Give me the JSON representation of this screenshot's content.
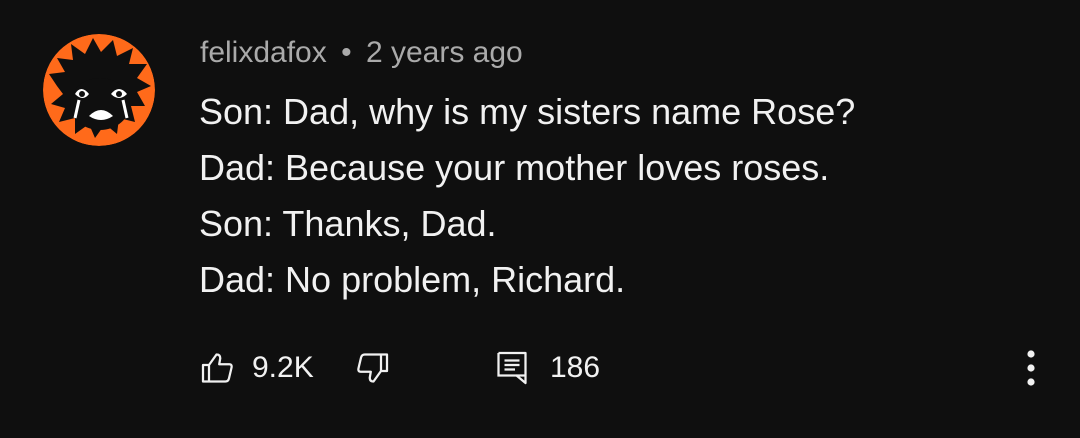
{
  "comment": {
    "author": "felixdafox",
    "separator": "•",
    "timestamp": "2 years ago",
    "lines": [
      "Son: Dad, why is my sisters name Rose?",
      "Dad: Because your mother loves roses.",
      "Son: Thanks, Dad.",
      "Dad: No problem, Richard."
    ],
    "avatar_colors": {
      "ring": "#ff6a1a",
      "inner": "#0f0f0f"
    }
  },
  "actions": {
    "like_count": "9.2K",
    "reply_count": "186",
    "like_icon": "thumbs-up-icon",
    "dislike_icon": "thumbs-down-icon",
    "reply_icon": "comment-icon",
    "more_icon": "more-vertical-icon"
  },
  "theme": {
    "background": "#0f0f0f",
    "primary_text": "#f1f1f1",
    "secondary_text": "#aaaaaa"
  }
}
